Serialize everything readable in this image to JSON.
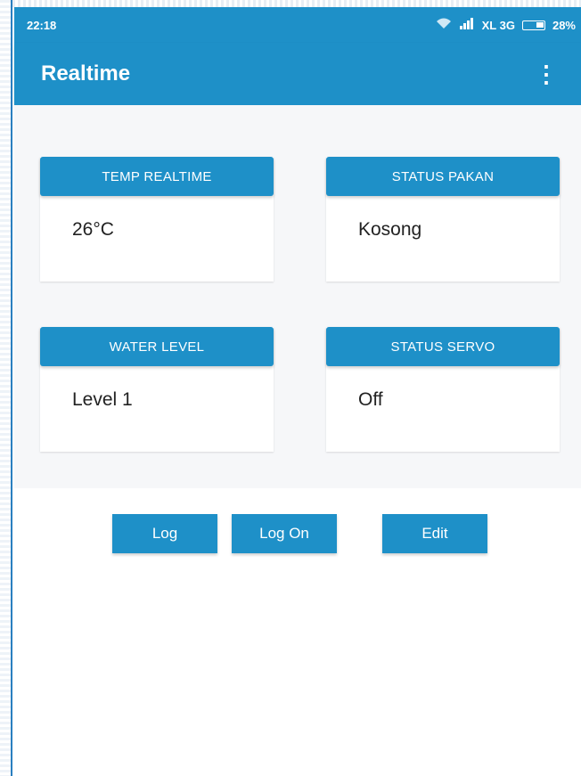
{
  "status_bar": {
    "time": "22:18",
    "signal_text": "XL 3G",
    "battery": "28%"
  },
  "app_bar": {
    "title": "Realtime",
    "menu_icon": "more-vert-icon"
  },
  "cards": [
    {
      "header": "TEMP REALTIME",
      "value": "26°C"
    },
    {
      "header": "STATUS PAKAN",
      "value": "Kosong"
    },
    {
      "header": "WATER LEVEL",
      "value": "Level 1"
    },
    {
      "header": "STATUS SERVO",
      "value": "Off"
    }
  ],
  "buttons": {
    "log": "Log",
    "log_on": "Log On",
    "edit": "Edit"
  },
  "colors": {
    "primary": "#1e90c8",
    "background": "#f6f7f9"
  }
}
